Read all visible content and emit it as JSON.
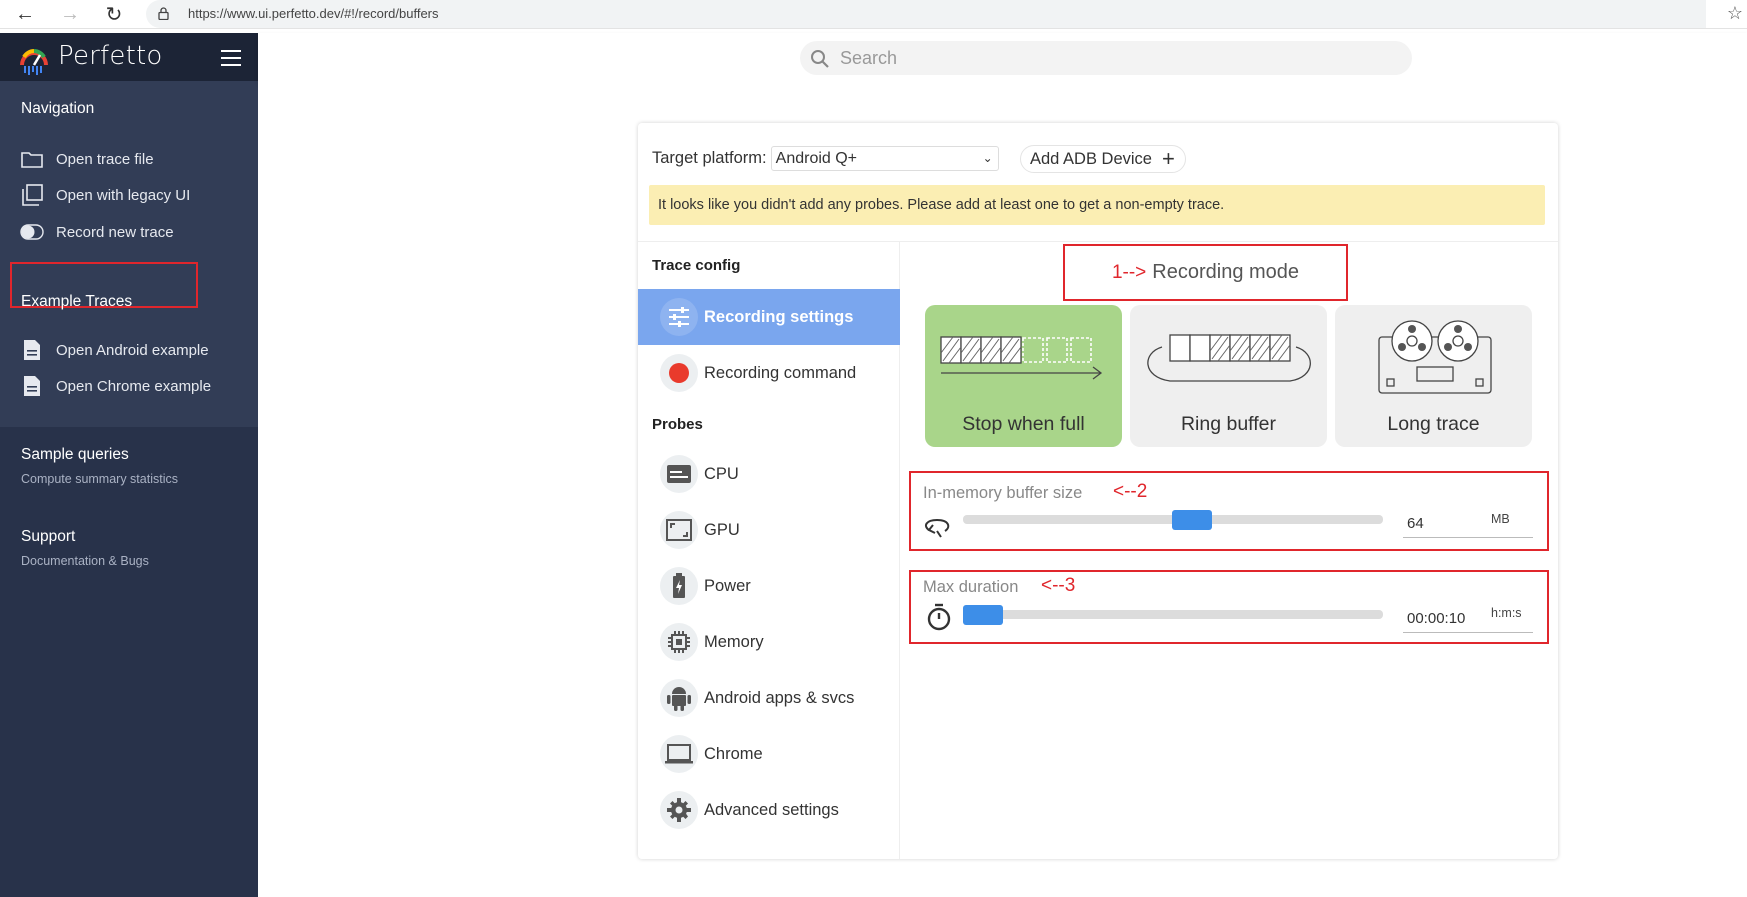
{
  "browser": {
    "url": "https://www.ui.perfetto.dev/#!/record/buffers"
  },
  "sidebar": {
    "app_name": "Perfetto",
    "navigation": {
      "title": "Navigation",
      "items": [
        {
          "label": "Open trace file",
          "icon": "folder-icon"
        },
        {
          "label": "Open with legacy UI",
          "icon": "filter-none-icon"
        },
        {
          "label": "Record new trace",
          "icon": "toggle-icon"
        }
      ]
    },
    "example_traces": {
      "title": "Example Traces",
      "items": [
        {
          "label": "Open Android example",
          "icon": "description-icon"
        },
        {
          "label": "Open Chrome example",
          "icon": "description-icon"
        }
      ]
    },
    "sample_queries": {
      "title": "Sample queries",
      "subtitle": "Compute summary statistics"
    },
    "support": {
      "title": "Support",
      "subtitle": "Documentation & Bugs"
    }
  },
  "search": {
    "placeholder": "Search"
  },
  "record": {
    "platform_label": "Target platform:",
    "platform_value": "Android Q+",
    "adb_button": "Add ADB Device",
    "warning": "It looks like you didn't add any probes. Please add at least one to get a non-empty trace.",
    "trace_config_title": "Trace config",
    "probes_title": "Probes",
    "config_items": [
      {
        "label": "Recording settings",
        "icon": "tune-icon",
        "active": true
      },
      {
        "label": "Recording command",
        "icon": "record-dot-icon",
        "active": false
      }
    ],
    "probe_items": [
      {
        "label": "CPU",
        "icon": "cpu-icon"
      },
      {
        "label": "GPU",
        "icon": "gpu-icon"
      },
      {
        "label": "Power",
        "icon": "battery-icon"
      },
      {
        "label": "Memory",
        "icon": "memory-icon"
      },
      {
        "label": "Android apps & svcs",
        "icon": "android-icon"
      },
      {
        "label": "Chrome",
        "icon": "laptop-icon"
      },
      {
        "label": "Advanced settings",
        "icon": "settings-icon"
      }
    ],
    "mode_annotation": "1-->",
    "mode_title": "Recording mode",
    "modes": [
      {
        "label": "Stop when full",
        "selected": true
      },
      {
        "label": "Ring buffer",
        "selected": false
      },
      {
        "label": "Long trace",
        "selected": false
      }
    ],
    "buffer": {
      "label": "In-memory buffer size",
      "annotation": "<--2",
      "value": "64",
      "unit": "MB",
      "slider_fraction": 0.55
    },
    "duration": {
      "label": "Max duration",
      "annotation": "<--3",
      "value": "00:00:10",
      "unit": "h:m:s",
      "slider_fraction": 0.0
    }
  },
  "colors": {
    "sidebar": "#28324a",
    "sidebar_section": "#323d56",
    "accent_blue": "#3d8ee8",
    "active_item": "#7aa6ee",
    "selected_mode": "#a9d58a",
    "warning_bg": "#fbeeb3",
    "annotation_red": "#e0262c"
  }
}
